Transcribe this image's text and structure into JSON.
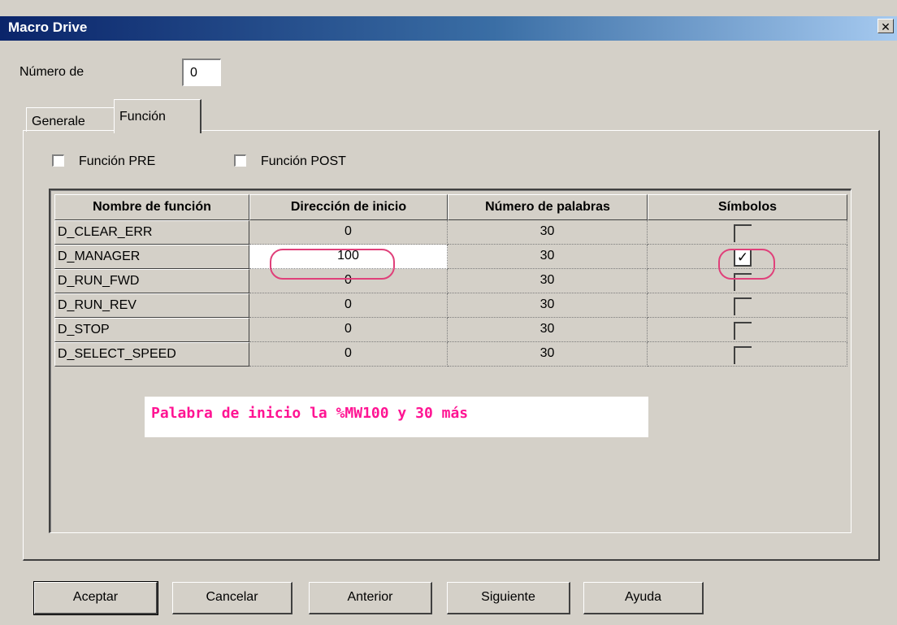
{
  "window": {
    "title": "Macro Drive",
    "close_glyph": "✕"
  },
  "numero": {
    "label": "Número de",
    "value": "0"
  },
  "tabs": [
    {
      "label": "Generale",
      "active": false
    },
    {
      "label": "Función",
      "active": true
    }
  ],
  "options": {
    "pre_label": "Función PRE",
    "post_label": "Función POST",
    "pre_checked": false,
    "post_checked": false
  },
  "grid": {
    "headers": [
      "Nombre de función",
      "Dirección de inicio",
      "Número de palabras",
      "Símbolos"
    ],
    "rows": [
      {
        "name": "D_CLEAR_ERR",
        "start": "0",
        "words": "30",
        "symbols": false
      },
      {
        "name": "D_MANAGER",
        "start": "100",
        "words": "30",
        "symbols": true
      },
      {
        "name": "D_RUN_FWD",
        "start": "0",
        "words": "30",
        "symbols": false
      },
      {
        "name": "D_RUN_REV",
        "start": "0",
        "words": "30",
        "symbols": false
      },
      {
        "name": "D_STOP",
        "start": "0",
        "words": "30",
        "symbols": false
      },
      {
        "name": "D_SELECT_SPEED",
        "start": "0",
        "words": "30",
        "symbols": false
      }
    ]
  },
  "annotation": {
    "text": "Palabra de inicio la %MW100 y 30 más",
    "color": "#ff1493"
  },
  "buttons": {
    "accept": "Aceptar",
    "cancel": "Cancelar",
    "previous": "Anterior",
    "next": "Siguiente",
    "help": "Ayuda"
  },
  "colors": {
    "titlebar_start": "#0a246a",
    "titlebar_end": "#a6caf0",
    "face": "#d4d0c8",
    "highlight": "#e0407a"
  }
}
